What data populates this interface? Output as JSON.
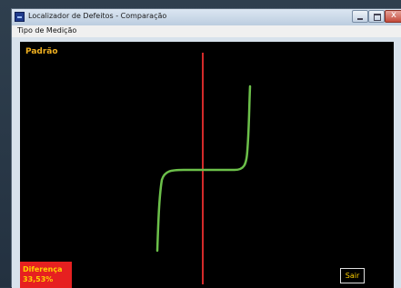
{
  "window": {
    "title": "Localizador de Defeitos - Comparação"
  },
  "menubar": {
    "items": [
      {
        "label": "Tipo de Medição"
      }
    ]
  },
  "plot": {
    "label": "Padrão",
    "colors": {
      "background": "#000000",
      "curve": "#6cc04a",
      "axis": "#d42a2a"
    }
  },
  "difference": {
    "label": "Diferença",
    "value": "33,53%",
    "color": "#e62020"
  },
  "buttons": {
    "exit_label": "Sair"
  }
}
